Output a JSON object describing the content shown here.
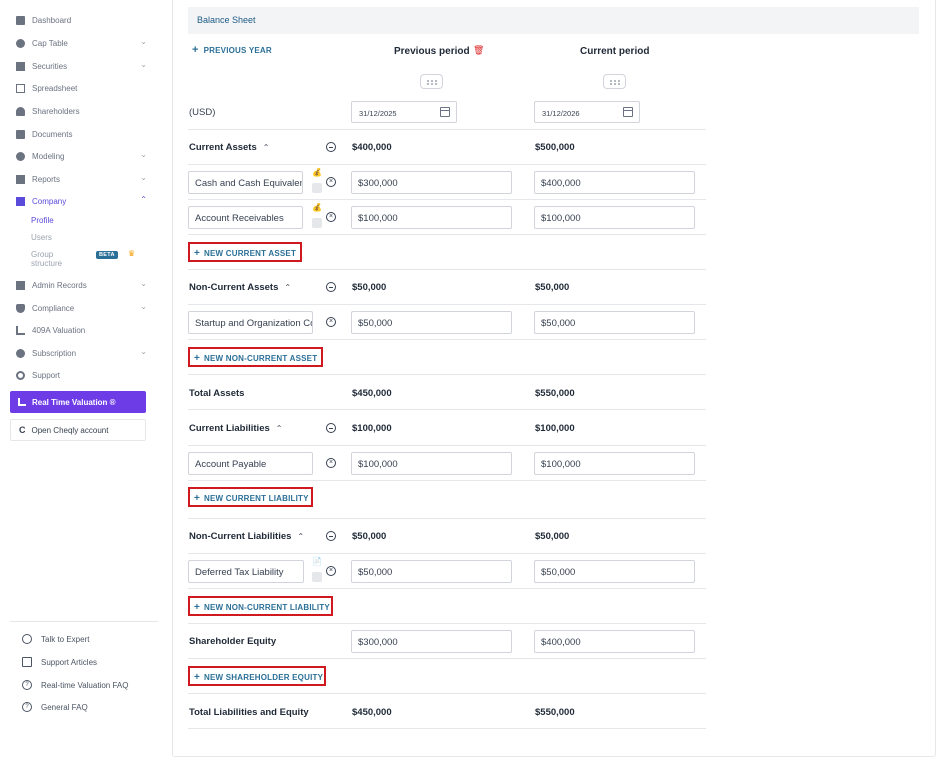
{
  "sidebar": {
    "items": [
      {
        "label": "Dashboard"
      },
      {
        "label": "Cap Table"
      },
      {
        "label": "Securities"
      },
      {
        "label": "Spreadsheet"
      },
      {
        "label": "Shareholders"
      },
      {
        "label": "Documents"
      },
      {
        "label": "Modeling"
      },
      {
        "label": "Reports"
      },
      {
        "label": "Company"
      },
      {
        "label": "Admin Records"
      },
      {
        "label": "Compliance"
      },
      {
        "label": "409A Valuation"
      },
      {
        "label": "Subscription"
      },
      {
        "label": "Support"
      }
    ],
    "company_sub": {
      "profile": "Profile",
      "users": "Users",
      "group_line1": "Group",
      "group_line2": "structure",
      "beta": "BETA"
    },
    "rtv_button": "Real Time Valuation ®",
    "cheqly_button": "Open Cheqly account",
    "help": [
      {
        "label": "Talk to Expert"
      },
      {
        "label": "Support Articles"
      },
      {
        "label": "Real-time Valuation FAQ"
      },
      {
        "label": "General FAQ"
      }
    ]
  },
  "main": {
    "section_title": "Balance Sheet",
    "previous_year_button": "PREVIOUS YEAR",
    "previous_period_title": "Previous period",
    "current_period_title": "Current period",
    "currency_label": "(USD)",
    "previous_date": "31/12/2025",
    "current_date": "31/12/2026",
    "current_assets": {
      "label": "Current Assets",
      "prev_total": "$400,000",
      "curr_total": "$500,000",
      "rows": [
        {
          "name": "Cash and Cash Equivalents",
          "prev": "$300,000",
          "curr": "$400,000"
        },
        {
          "name": "Account Receivables",
          "prev": "$100,000",
          "curr": "$100,000"
        }
      ],
      "add_button": "NEW CURRENT ASSET"
    },
    "non_current_assets": {
      "label": "Non-Current Assets",
      "prev_total": "$50,000",
      "curr_total": "$50,000",
      "rows": [
        {
          "name": "Startup and Organization Costs",
          "prev": "$50,000",
          "curr": "$50,000"
        }
      ],
      "add_button": "NEW NON-CURRENT ASSET"
    },
    "total_assets": {
      "label": "Total Assets",
      "prev": "$450,000",
      "curr": "$550,000"
    },
    "current_liabilities": {
      "label": "Current Liabilities",
      "prev_total": "$100,000",
      "curr_total": "$100,000",
      "rows": [
        {
          "name": "Account Payable",
          "prev": "$100,000",
          "curr": "$100,000"
        }
      ],
      "add_button": "NEW CURRENT LIABILITY"
    },
    "non_current_liabilities": {
      "label": "Non-Current Liabilities",
      "prev_total": "$50,000",
      "curr_total": "$50,000",
      "rows": [
        {
          "name": "Deferred Tax Liability",
          "prev": "$50,000",
          "curr": "$50,000"
        }
      ],
      "add_button": "NEW NON-CURRENT LIABILITY"
    },
    "shareholder_equity": {
      "label": "Shareholder Equity",
      "prev": "$300,000",
      "curr": "$400,000",
      "add_button": "NEW SHAREHOLDER EQUITY"
    },
    "total_liabilities_equity": {
      "label": "Total Liabilities and Equity",
      "prev": "$450,000",
      "curr": "$550,000"
    }
  },
  "colors": {
    "accent": "#5b4bdb",
    "link": "#2a6f97",
    "highlight_border": "#d0191f",
    "rtv_button": "#6d3ce6"
  }
}
